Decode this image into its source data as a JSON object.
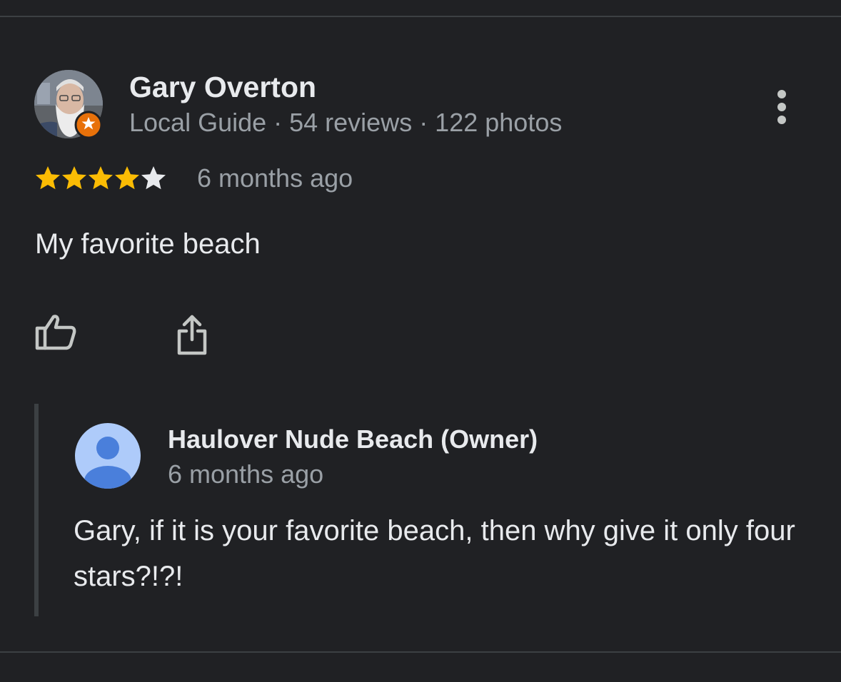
{
  "review": {
    "reviewer": {
      "name": "Gary Overton",
      "meta": "Local Guide · 54 reviews · 122 photos",
      "badge_icon": "local-guide-badge-icon"
    },
    "rating": {
      "value": 4,
      "max": 5,
      "filled_color": "#fbbc04",
      "empty_color": "#e8eaed"
    },
    "time": "6 months ago",
    "text": "My favorite beach",
    "actions": {
      "like_icon": "thumbs-up-icon",
      "share_icon": "share-icon",
      "more_icon": "more-vertical-icon"
    },
    "owner_response": {
      "name": "Haulover Nude Beach (Owner)",
      "time": "6 months ago",
      "text": "Gary, if it is your favorite beach, then why give it only four stars?!?!",
      "avatar_icon": "default-profile-icon",
      "avatar_color": "#aecbfa",
      "avatar_figure_color": "#4a7fdb"
    }
  },
  "theme": {
    "background": "#202124",
    "primary_text": "#e8eaed",
    "secondary_text": "#9aa0a6",
    "divider": "#3c4043",
    "badge_color": "#e8710a"
  }
}
